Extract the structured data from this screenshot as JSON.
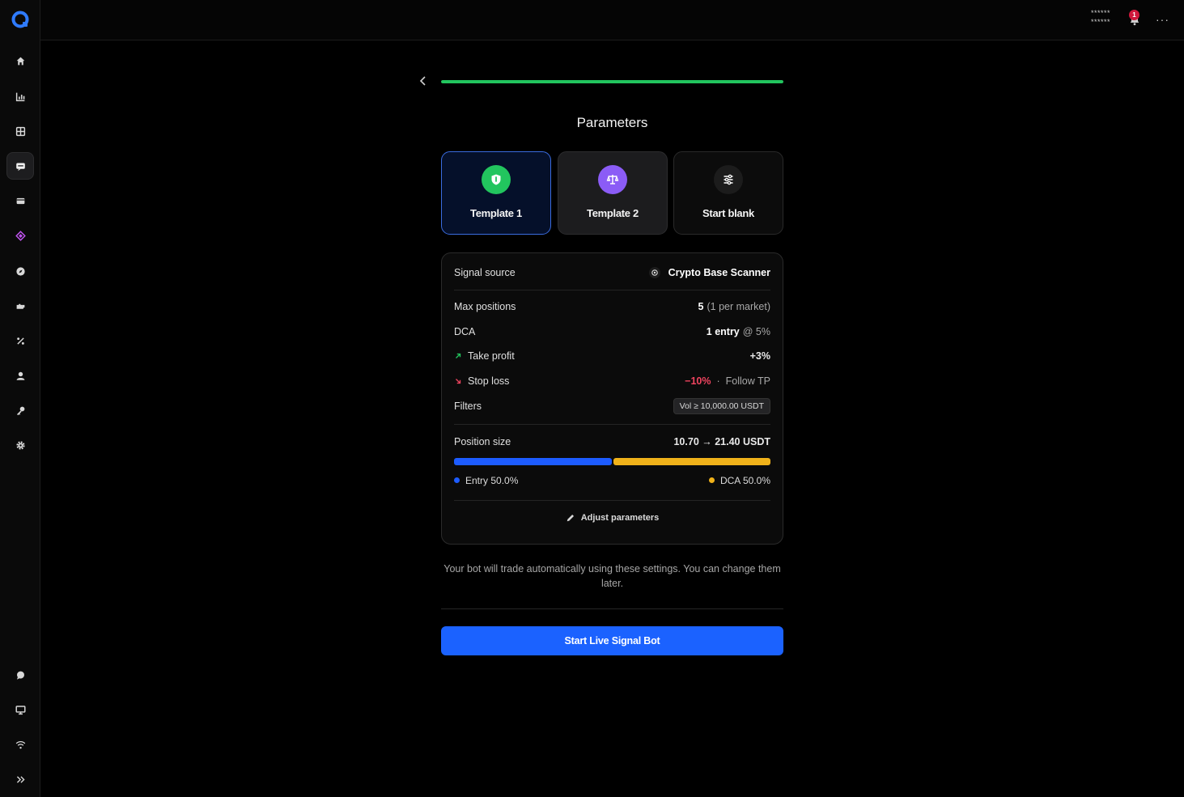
{
  "topbar": {
    "account_line1": "******",
    "account_line2": "******",
    "notification_count": "1",
    "more_label": "···"
  },
  "sidebar": {
    "items": [
      {
        "name": "home-icon"
      },
      {
        "name": "chart-icon"
      },
      {
        "name": "grid-icon"
      },
      {
        "name": "bot-icon",
        "active": true
      },
      {
        "name": "wallet-icon"
      },
      {
        "name": "diamond-icon"
      },
      {
        "name": "compass-icon"
      },
      {
        "name": "puzzle-icon"
      },
      {
        "name": "percent-icon"
      },
      {
        "name": "user-icon"
      },
      {
        "name": "key-icon"
      },
      {
        "name": "gear-icon"
      },
      {
        "name": "chat-icon"
      },
      {
        "name": "monitor-icon"
      },
      {
        "name": "wifi-icon"
      },
      {
        "name": "expand-icon"
      }
    ]
  },
  "wizard": {
    "progress": 1.0,
    "title": "Parameters",
    "templates": [
      {
        "label": "Template 1",
        "icon": "shield-icon",
        "color": "#22c55e",
        "selected": true
      },
      {
        "label": "Template 2",
        "icon": "scale-icon",
        "color": "#8b5cf6",
        "selected": false
      },
      {
        "label": "Start blank",
        "icon": "sliders-icon",
        "color": "#1c1c1c",
        "selected": false
      }
    ]
  },
  "summary": {
    "signal_source_label": "Signal source",
    "signal_source_value": "Crypto Base Scanner",
    "max_positions_label": "Max positions",
    "max_positions_value": "5",
    "max_positions_note": "(1 per market)",
    "dca_label": "DCA",
    "dca_value": "1 entry",
    "dca_note": "@ 5%",
    "take_profit_label": "Take profit",
    "take_profit_value": "+3%",
    "stop_loss_label": "Stop loss",
    "stop_loss_value": "−10%",
    "stop_loss_sep": "·",
    "stop_loss_note": "Follow TP",
    "filters_label": "Filters",
    "filters_value": "Vol ≥ 10,000.00 USDT",
    "position_size_label": "Position size",
    "position_size_value": "10.70 → 21.40 USDT",
    "entry_share": 50.0,
    "dca_share": 50.0,
    "entry_legend": "Entry 50.0%",
    "dca_legend": "DCA 50.0%",
    "adjust_label": "Adjust parameters"
  },
  "colors": {
    "entry": "#1d5cff",
    "dca": "#f0b21a",
    "accent": "#1b62ff"
  },
  "note": "Your bot will trade automatically using these settings. You can change them later.",
  "cta_label": "Start Live Signal Bot"
}
